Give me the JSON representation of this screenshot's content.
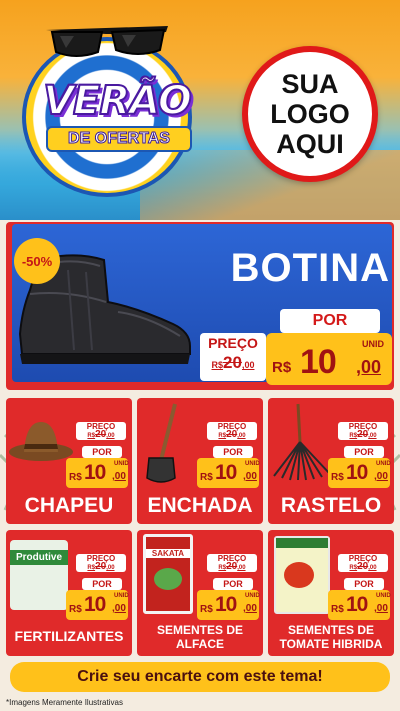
{
  "brand": {
    "title": "VERÃO",
    "subtitle": "DE OFERTAS",
    "logo_lines": [
      "SUA",
      "LOGO",
      "AQUI"
    ]
  },
  "colors": {
    "red": "#e02a2a",
    "blue": "#1e4bb0",
    "yellow": "#ffc11a",
    "dark_red": "#a01212"
  },
  "featured": {
    "discount": "-50%",
    "name": "BOTINA",
    "preco_label": "PREÇO",
    "old_price": "20",
    "old_cents": ",00",
    "old_currency": "R$",
    "por_label": "POR",
    "currency": "R$",
    "price": "10",
    "cents": ",00",
    "unit": "UNID",
    "icon": "boot-icon"
  },
  "products": [
    {
      "name": "CHAPEU",
      "preco_label": "PREÇO",
      "old_currency": "R$",
      "old_price": "20",
      "old_cents": ",00",
      "por_label": "POR",
      "currency": "R$",
      "price": "10",
      "cents": ",00",
      "unit": "UNID",
      "icon": "hat-icon"
    },
    {
      "name": "ENCHADA",
      "preco_label": "PREÇO",
      "old_currency": "R$",
      "old_price": "20",
      "old_cents": ",00",
      "por_label": "POR",
      "currency": "R$",
      "price": "10",
      "cents": ",00",
      "unit": "UNID",
      "icon": "hoe-icon"
    },
    {
      "name": "RASTELO",
      "preco_label": "PREÇO",
      "old_currency": "R$",
      "old_price": "20",
      "old_cents": ",00",
      "por_label": "POR",
      "currency": "R$",
      "price": "10",
      "cents": ",00",
      "unit": "UNID",
      "icon": "rake-icon"
    },
    {
      "name": "FERTILIZANTES",
      "preco_label": "PREÇO",
      "old_currency": "R$",
      "old_price": "20",
      "old_cents": ",00",
      "por_label": "POR",
      "currency": "R$",
      "price": "10",
      "cents": ",00",
      "unit": "UNID",
      "icon": "fertilizer-bag-icon",
      "pack_text": "Produtive"
    },
    {
      "name": "SEMENTES DE ALFACE",
      "preco_label": "PREÇO",
      "old_currency": "R$",
      "old_price": "20",
      "old_cents": ",00",
      "por_label": "POR",
      "currency": "R$",
      "price": "10",
      "cents": ",00",
      "unit": "UNID",
      "icon": "seed-packet-icon",
      "pack_text": "SAKATA"
    },
    {
      "name": "SEMENTES DE TOMATE HIBRIDA",
      "preco_label": "PREÇO",
      "old_currency": "R$",
      "old_price": "20",
      "old_cents": ",00",
      "por_label": "POR",
      "currency": "R$",
      "price": "10",
      "cents": ",00",
      "unit": "UNID",
      "icon": "tomato-seed-packet-icon"
    }
  ],
  "cta": "Crie seu encarte com este tema!",
  "disclaimer": "*Imagens Meramente Ilustrativas"
}
